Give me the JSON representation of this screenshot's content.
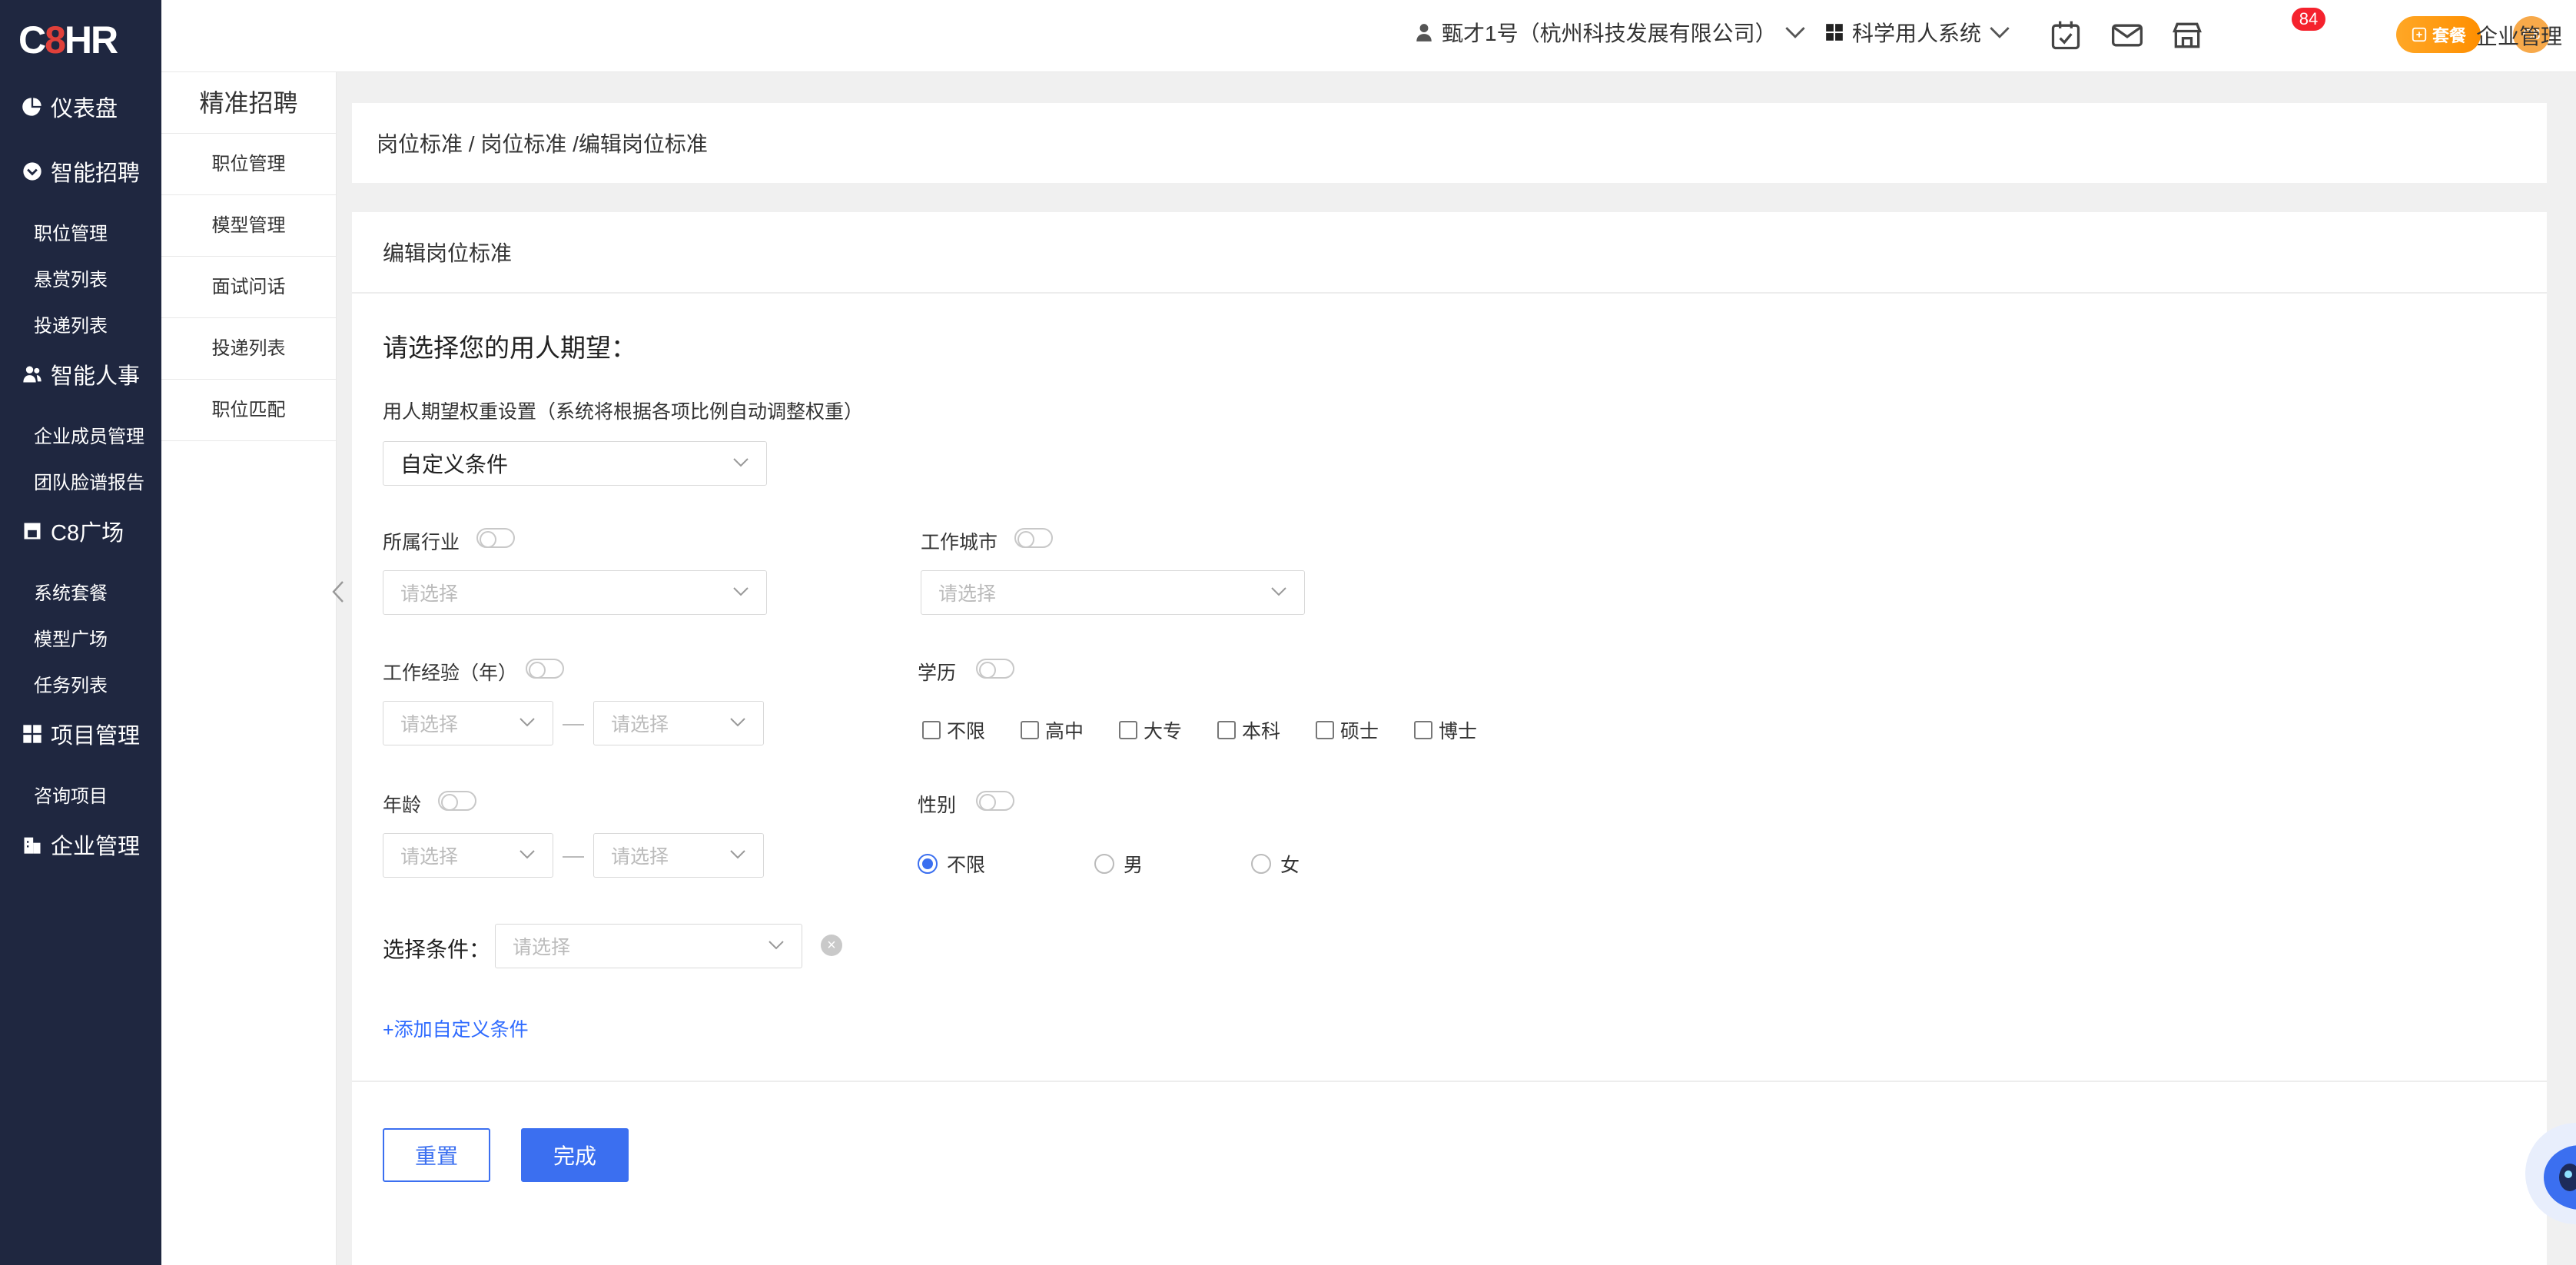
{
  "logo": {
    "c": "C",
    "eight": "8",
    "hr": "HR"
  },
  "sidebar": {
    "groups": [
      {
        "label": "仪表盘",
        "icon": "pie-chart-icon"
      },
      {
        "label": "智能招聘",
        "icon": "chevron-circle-icon",
        "items": [
          "职位管理",
          "悬赏列表",
          "投递列表"
        ]
      },
      {
        "label": "智能人事",
        "icon": "users-icon",
        "items": [
          "企业成员管理",
          "团队脸谱报告"
        ]
      },
      {
        "label": "C8广场",
        "icon": "store-icon",
        "items": [
          "系统套餐",
          "模型广场",
          "任务列表"
        ]
      },
      {
        "label": "项目管理",
        "icon": "grid-icon",
        "items": [
          "咨询项目"
        ]
      },
      {
        "label": "企业管理",
        "icon": "building-icon",
        "items": []
      }
    ]
  },
  "topbar": {
    "user": "甄才1号（杭州科技发展有限公司）",
    "system": "科学用人系统",
    "mail_badge": "84",
    "package": "套餐",
    "c8": "C8",
    "account": "企业管理"
  },
  "subnav": {
    "title": "精准招聘",
    "items": [
      "职位管理",
      "模型管理",
      "面试问话",
      "投递列表",
      "职位匹配"
    ]
  },
  "breadcrumb": "岗位标准 / 岗位标准 /编辑岗位标准",
  "card": {
    "header": "编辑岗位标准",
    "section_title": "请选择您的用人期望：",
    "weight_hint": "用人期望权重设置（系统将根据各项比例自动调整权重）",
    "weight_select": "自定义条件",
    "placeholder": "请选择",
    "industry_label": "所属行业",
    "city_label": "工作城市",
    "experience_label": "工作经验（年）",
    "education_label": "学历",
    "education_options": [
      "不限",
      "高中",
      "大专",
      "本科",
      "硕士",
      "博士"
    ],
    "age_label": "年龄",
    "gender_label": "性别",
    "gender_options": [
      "不限",
      "男",
      "女"
    ],
    "condition_label": "选择条件：",
    "add_link": "+添加自定义条件",
    "reset": "重置",
    "done": "完成"
  },
  "colors": {
    "sidebar_bg": "#1f2740",
    "accent": "#3b6ff0",
    "badge": "#f5222d",
    "package": "#ff9800"
  }
}
